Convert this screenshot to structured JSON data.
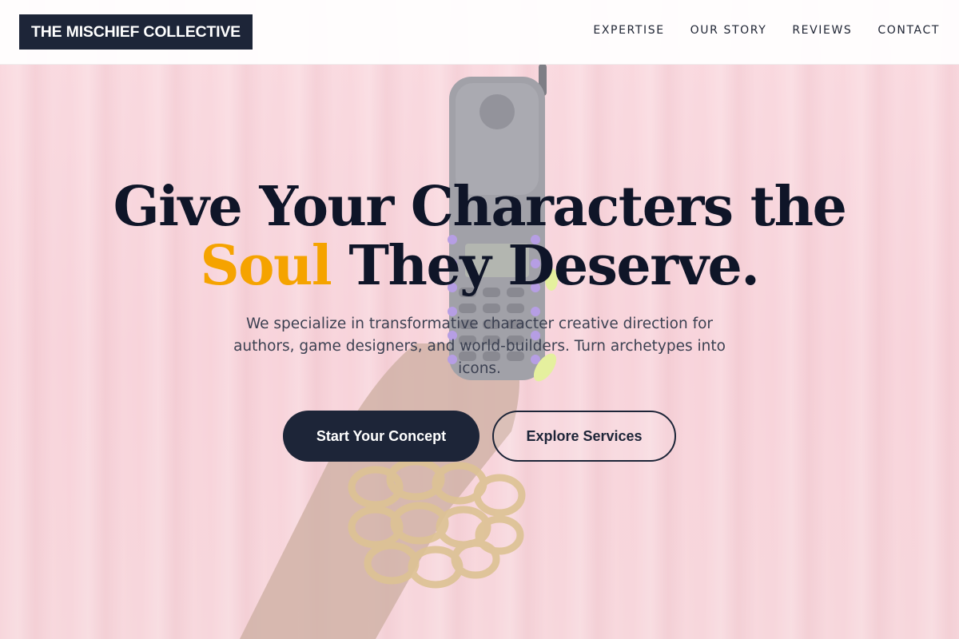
{
  "header": {
    "logo_text": "THE MISCHIEF COLLECTIVE",
    "nav": [
      {
        "label": "EXPERTISE"
      },
      {
        "label": "OUR STORY"
      },
      {
        "label": "REVIEWS"
      },
      {
        "label": "CONTACT"
      }
    ]
  },
  "hero": {
    "title_line1": "Give Your Characters the",
    "title_accent": "Soul",
    "title_line2_rest": " They Deserve.",
    "subtitle": "We specialize in transformative character creative direction for authors, game designers, and world-builders. Turn archetypes into icons.",
    "primary_button": "Start Your Concept",
    "secondary_button": "Explore Services"
  },
  "colors": {
    "brand_dark": "#1d2538",
    "accent": "#f5a300",
    "background_pink": "#f6c9d0"
  },
  "icons": [
    "hero-photo-hand-phone"
  ]
}
